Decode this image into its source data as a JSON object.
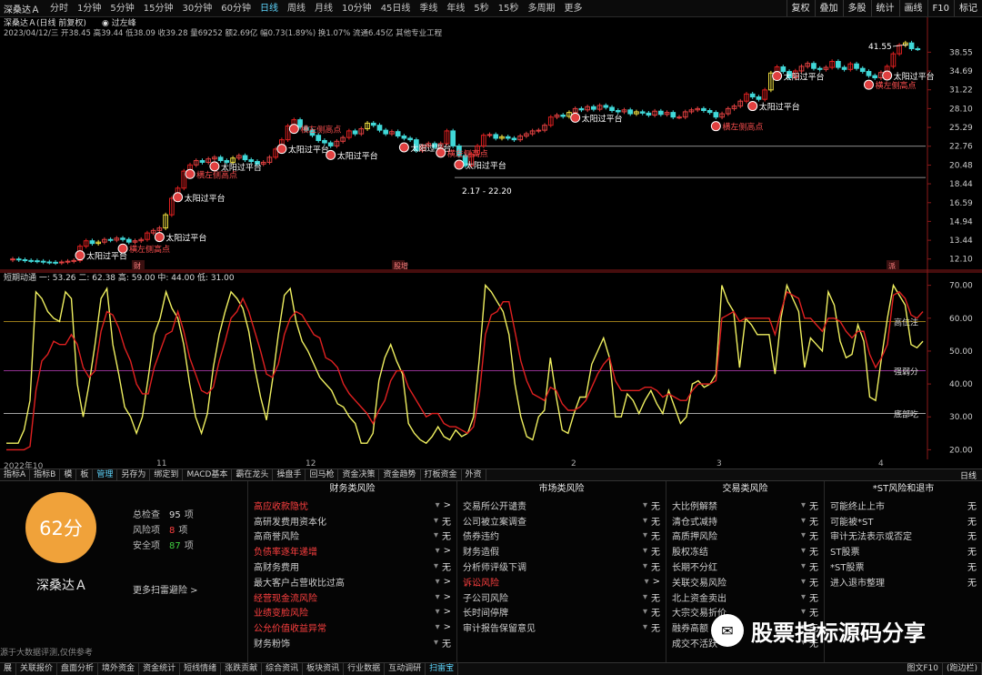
{
  "top_bar": {
    "symbol": "深桑达Ａ",
    "periods": [
      "分时",
      "1分钟",
      "5分钟",
      "15分钟",
      "30分钟",
      "60分钟",
      "日线",
      "周线",
      "月线",
      "10分钟",
      "45日线",
      "季线",
      "年线",
      "5秒",
      "15秒",
      "多周期",
      "更多"
    ],
    "active_period": "日线",
    "right_buttons": [
      "复权",
      "叠加",
      "多股",
      "统计",
      "画线",
      "F10",
      "标记"
    ]
  },
  "price_info": {
    "title": "深桑达Ａ(日线 前复权)",
    "indicator_name": "过左峰",
    "line1": "2023/04/12/三 开38.45 高39.44 低38.09 收39.28 量69252 额2.69亿 幅0.73(1.89%) 换1.07% 流通6.45亿 其他专业工程"
  },
  "oscillator": {
    "header": "短期动通 一: 53.26  二: 62.38  高: 59.00  中: 44.00  低: 31.00",
    "levels": [
      {
        "value": 59.0,
        "label": "高位注",
        "color": "#c8a020"
      },
      {
        "value": 44.0,
        "label": "强弱分",
        "color": "#c040c0"
      },
      {
        "value": 31.0,
        "label": "底部吃",
        "color": "#d8d8d8"
      }
    ]
  },
  "date_axis": {
    "labels": [
      "2022年10",
      "11",
      "12",
      "2",
      "3",
      "4"
    ]
  },
  "tab_bar": {
    "tabs": [
      "指标A",
      "指标B",
      "模",
      "板",
      "管理",
      "另存为",
      "绑定到",
      "MACD基本",
      "霸在龙头",
      "操盘手",
      "回马枪",
      "资金决策",
      "资金趋势",
      "打板资金",
      "外资"
    ],
    "active_tab": "管理",
    "period_label": "日线"
  },
  "scan_panel": {
    "score": "62分",
    "stock_name": "深桑达Ａ",
    "stats": [
      {
        "label": "总检查",
        "value": "95",
        "unit": "项",
        "color": "#dddddd"
      },
      {
        "label": "风险项",
        "value": "8",
        "unit": "项",
        "color": "#ff4040"
      },
      {
        "label": "安全项",
        "value": "87",
        "unit": "项",
        "color": "#40d040"
      }
    ],
    "more_link": "更多扫雷避险 >",
    "bottom_note": "源于大数据评测,仅供参考",
    "columns": [
      {
        "title": "财务类风险",
        "rows": [
          {
            "label": "高应收款隐忧",
            "red": true,
            "value": ">"
          },
          {
            "label": "高研发费用资本化",
            "red": false,
            "value": "无"
          },
          {
            "label": "高商誉风险",
            "red": false,
            "value": "无"
          },
          {
            "label": "负债率逐年递增",
            "red": true,
            "value": ">"
          },
          {
            "label": "高财务费用",
            "red": false,
            "value": "无"
          },
          {
            "label": "最大客户占营收比过高",
            "red": false,
            "value": ">"
          },
          {
            "label": "经营现金流风险",
            "red": true,
            "value": ">"
          },
          {
            "label": "业绩变脸风险",
            "red": true,
            "value": ">"
          },
          {
            "label": "公允价值收益异常",
            "red": true,
            "value": ">"
          },
          {
            "label": "财务粉饰",
            "red": false,
            "value": "无"
          }
        ]
      },
      {
        "title": "市场类风险",
        "rows": [
          {
            "label": "交易所公开谴责",
            "red": false,
            "value": "无"
          },
          {
            "label": "公司被立案调查",
            "red": false,
            "value": "无"
          },
          {
            "label": "债券违约",
            "red": false,
            "value": "无"
          },
          {
            "label": "财务造假",
            "red": false,
            "value": "无"
          },
          {
            "label": "分析师评级下调",
            "red": false,
            "value": "无"
          },
          {
            "label": "诉讼风险",
            "red": true,
            "value": ">"
          },
          {
            "label": "子公司风险",
            "red": false,
            "value": "无"
          },
          {
            "label": "长时间停牌",
            "red": false,
            "value": "无"
          },
          {
            "label": "审计报告保留意见",
            "red": false,
            "value": "无"
          }
        ]
      },
      {
        "title": "交易类风险",
        "rows": [
          {
            "label": "大比例解禁",
            "red": false,
            "value": "无"
          },
          {
            "label": "清仓式减持",
            "red": false,
            "value": "无"
          },
          {
            "label": "高质押风险",
            "red": false,
            "value": "无"
          },
          {
            "label": "股权冻结",
            "red": false,
            "value": "无"
          },
          {
            "label": "长期不分红",
            "red": false,
            "value": "无"
          },
          {
            "label": "关联交易风险",
            "red": false,
            "value": "无"
          },
          {
            "label": "北上资金卖出",
            "red": false,
            "value": "无"
          },
          {
            "label": "大宗交易折价",
            "red": false,
            "value": "无"
          },
          {
            "label": "融券高额",
            "red": false,
            "value": "无"
          },
          {
            "label": "成交不活跃",
            "red": false,
            "value": "无"
          }
        ]
      },
      {
        "title": "*ST风险和退市",
        "rows": [
          {
            "label": "可能终止上市",
            "red": false,
            "value": "无"
          },
          {
            "label": "可能被*ST",
            "red": false,
            "value": "无"
          },
          {
            "label": "审计无法表示或否定",
            "red": false,
            "value": "无"
          },
          {
            "label": "ST股票",
            "red": false,
            "value": "无"
          },
          {
            "label": "*ST股票",
            "red": false,
            "value": "无"
          },
          {
            "label": "进入退市整理",
            "red": false,
            "value": "无"
          }
        ]
      }
    ]
  },
  "watermark": {
    "icon_name": "wechat-icon",
    "text": "股票指标源码分享"
  },
  "bottom_bar": {
    "tabs": [
      "展",
      "关联报价",
      "盘面分析",
      "境外资金",
      "资金统计",
      "短线情绪",
      "涨跌贡献",
      "综合资讯",
      "板块资讯",
      "行业数据",
      "互动调研",
      "扫雷宝"
    ],
    "active_tab": "扫雷宝",
    "right_tabs": [
      "图文F10",
      "(跑边栏)"
    ]
  },
  "chart_data": [
    {
      "type": "candlestick",
      "title": "深桑达Ａ(日线 前复权)",
      "y_ticks": [
        38.55,
        34.69,
        31.22,
        28.1,
        25.29,
        22.76,
        20.48,
        18.44,
        16.59,
        14.94,
        13.44,
        12.1
      ],
      "ylim": [
        11.6,
        41.9
      ],
      "annotations": {
        "marker_labels": [
          "太阳过平台",
          "横左侧高点",
          "2.17 - 22.20"
        ],
        "high_label": "41.55",
        "reference_lines": [
          22.76,
          19.1
        ],
        "event_labels": [
          "财",
          "股增",
          "派"
        ]
      },
      "closes": [
        12.1,
        12.05,
        12.0,
        11.98,
        11.95,
        11.9,
        11.88,
        11.85,
        11.9,
        11.95,
        12.0,
        13.0,
        13.4,
        13.2,
        13.3,
        13.5,
        13.45,
        13.6,
        13.5,
        13.3,
        13.4,
        13.5,
        14.0,
        14.2,
        14.4,
        15.5,
        17.0,
        18.0,
        19.8,
        20.5,
        21.0,
        20.8,
        21.2,
        21.4,
        21.0,
        20.8,
        21.3,
        21.6,
        21.1,
        20.9,
        20.6,
        20.8,
        21.4,
        22.4,
        23.6,
        25.5,
        26.4,
        25.3,
        24.9,
        24.2,
        23.5,
        23.2,
        22.8,
        23.4,
        23.9,
        24.8,
        24.4,
        25.1,
        25.9,
        25.6,
        24.9,
        24.4,
        24.7,
        24.1,
        23.8,
        23.6,
        22.2,
        22.8,
        23.1,
        22.6,
        23.1,
        24.8,
        22.8,
        21.6,
        20.4,
        21.8,
        22.8,
        24.2,
        24.3,
        23.8,
        24.0,
        23.8,
        23.6,
        24.1,
        24.4,
        24.8,
        24.9,
        25.6,
        26.8,
        27.1,
        26.9,
        27.5,
        28.1,
        27.9,
        28.4,
        28.0,
        28.6,
        28.3,
        27.8,
        27.6,
        27.9,
        27.3,
        27.6,
        27.4,
        27.1,
        27.7,
        27.2,
        27.5,
        26.8,
        26.8,
        27.6,
        27.9,
        28.1,
        27.8,
        27.5,
        26.8,
        27.3,
        28.1,
        28.5,
        29.3,
        30.5,
        30.0,
        29.6,
        31.2,
        34.3,
        35.5,
        34.6,
        33.4,
        34.7,
        35.6,
        36.2,
        35.2,
        35.0,
        35.4,
        36.6,
        35.4,
        35.0,
        36.1,
        35.2,
        34.6,
        33.8,
        33.4,
        34.4,
        35.6,
        38.2,
        40.1,
        40.6,
        39.3,
        39.28
      ]
    },
    {
      "type": "line",
      "title": "短期动通",
      "ylim": [
        19,
        71
      ],
      "y_ticks": [
        70.0,
        60.0,
        50.0,
        40.0,
        30.0,
        20.0
      ],
      "series": [
        {
          "name": "一",
          "color": "#f0f060",
          "values": [
            22,
            22,
            22,
            26,
            35,
            68,
            66,
            62,
            60,
            59,
            68,
            66,
            40,
            30,
            40,
            52,
            66,
            69,
            52,
            43,
            33,
            30,
            25,
            30,
            42,
            55,
            60,
            68,
            63,
            60,
            52,
            40,
            30,
            25,
            31,
            45,
            55,
            62,
            68,
            66,
            63,
            56,
            45,
            36,
            29,
            41,
            55,
            67,
            69,
            59,
            53,
            50,
            46,
            42,
            40,
            38,
            34,
            33,
            30,
            28,
            22,
            22,
            25,
            41,
            48,
            52,
            47,
            43,
            28,
            25,
            23,
            22,
            24,
            27,
            24,
            23,
            26,
            24,
            25,
            30,
            48,
            70,
            68,
            65,
            62,
            55,
            40,
            30,
            24,
            23,
            30,
            32,
            48,
            36,
            26,
            25,
            31,
            36,
            36,
            46,
            50,
            54,
            48,
            30,
            30,
            37,
            35,
            31,
            35,
            38,
            34,
            31,
            38,
            33,
            28,
            30,
            40,
            41,
            39,
            40,
            43,
            70,
            65,
            62,
            45,
            60,
            58,
            55,
            55,
            55,
            43,
            60,
            70,
            66,
            62,
            45,
            54,
            52,
            50,
            68,
            64,
            53,
            48,
            49,
            58,
            53,
            36,
            35,
            48,
            60,
            70,
            67,
            64,
            52,
            51,
            53
          ]
        },
        {
          "name": "二",
          "color": "#e02020",
          "values": [
            20,
            20,
            20,
            20,
            21,
            38,
            47,
            49,
            53,
            52,
            52,
            55,
            52,
            45,
            42,
            44,
            56,
            62,
            61,
            57,
            51,
            47,
            40,
            37,
            37,
            45,
            50,
            55,
            56,
            62,
            56,
            48,
            43,
            38,
            37,
            39,
            47,
            53,
            60,
            62,
            66,
            62,
            56,
            50,
            43,
            42,
            46,
            55,
            60,
            62,
            61,
            58,
            55,
            54,
            48,
            47,
            45,
            40,
            37,
            35,
            33,
            31,
            28,
            32,
            35,
            41,
            44,
            44,
            39,
            36,
            33,
            30,
            31,
            31,
            28,
            27,
            27,
            26,
            25,
            27,
            37,
            55,
            61,
            62,
            65,
            65,
            56,
            47,
            41,
            37,
            36,
            35,
            39,
            38,
            34,
            32,
            32,
            33,
            35,
            39,
            43,
            46,
            48,
            41,
            38,
            38,
            38,
            38,
            39,
            39,
            38,
            36,
            37,
            36,
            35,
            35,
            38,
            40,
            40,
            40,
            41,
            60,
            61,
            62,
            59,
            60,
            60,
            60,
            60,
            60,
            55,
            62,
            68,
            67,
            66,
            60,
            60,
            58,
            56,
            60,
            60,
            59,
            56,
            54,
            56,
            56,
            49,
            45,
            48,
            52,
            67,
            68,
            66,
            61,
            60,
            62
          ]
        }
      ]
    }
  ]
}
